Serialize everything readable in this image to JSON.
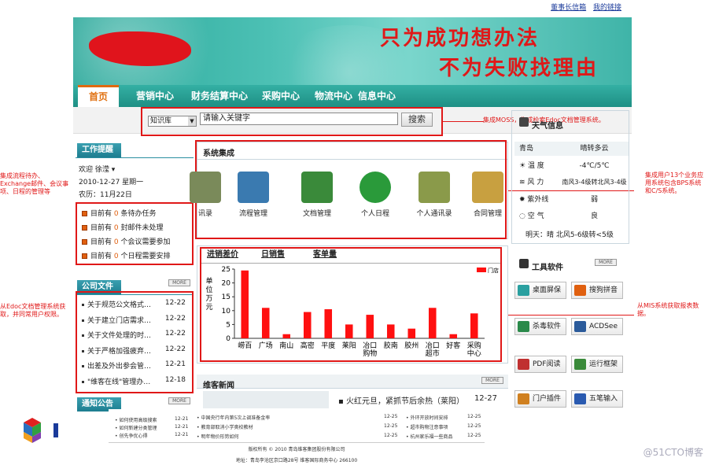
{
  "top_links": [
    "董事长信箱",
    "我的链接"
  ],
  "banner": {
    "slogan1": "只为成功想办法",
    "slogan2": "不为失败找理由"
  },
  "nav": [
    "首页",
    "营销中心",
    "财务结算中心",
    "采购中心",
    "物流中心",
    "信息中心"
  ],
  "search": {
    "kb_value": "知识库",
    "placeholder": "请输入关键字",
    "button": "搜索"
  },
  "annotations": {
    "search": "集成MOSS，集成检索Edoc文档管理系统。",
    "left_work": "集成流程待办、Exchange邮件、会议事项、日程的管理等",
    "left_docs": "从Edoc文档管理系统获取，并同常用户权限。",
    "right_sys": "集成用户13个业务应用系统包含BPS系统和C/S系统。",
    "right_chart": "从MIS系统获取报表数据。"
  },
  "work": {
    "title": "工作提醒",
    "welcome": "欢迎 徐滢",
    "date": "2010-12-27 星期一",
    "lunar": "农历：11月22日",
    "tasks": [
      {
        "pre": "目前有",
        "n": "0",
        "post": "条待办任务"
      },
      {
        "pre": "目前有",
        "n": "0",
        "post": "封邮件未处理"
      },
      {
        "pre": "目前有",
        "n": "0",
        "post": "个会议需要参加"
      },
      {
        "pre": "目前有",
        "n": "0",
        "post": "个日程需要安排"
      }
    ]
  },
  "docs": {
    "title": "公司文件",
    "more": "MORE",
    "items": [
      {
        "t": "关于规范公文格式…",
        "d": "12-22"
      },
      {
        "t": "关于建立门店需求…",
        "d": "12-22"
      },
      {
        "t": "关于文件处理的时…",
        "d": "12-22"
      },
      {
        "t": "关于严格加强疲弃…",
        "d": "12-22"
      },
      {
        "t": "出差及外出参会管…",
        "d": "12-21"
      },
      {
        "t": "\"维客在线\"管理办…",
        "d": "12-18"
      }
    ]
  },
  "notice": {
    "title": "通知公告",
    "more": "MORE"
  },
  "system": {
    "title": "系统集成",
    "items": [
      {
        "label": "讯录",
        "color": "#7a8a5a"
      },
      {
        "label": "流程管理",
        "color": "#3a7ab0"
      },
      {
        "label": "文档管理",
        "color": "#3a8a3a"
      },
      {
        "label": "个人日程",
        "color": "#2a9a3a"
      },
      {
        "label": "个人通讯录",
        "color": "#8a9a4a"
      },
      {
        "label": "合同管理",
        "color": "#c8a040"
      }
    ]
  },
  "chart_tabs": [
    "进销差价",
    "日销售",
    "客单量"
  ],
  "chart_data": {
    "type": "bar",
    "categories": [
      "崂百",
      "广场",
      "南山",
      "高密",
      "平度",
      "莱阳",
      "冶口购物",
      "胶南",
      "胶州",
      "冶口超市",
      "好客",
      "采购中心"
    ],
    "values": [
      24.5,
      11,
      1.5,
      9.5,
      10.5,
      5,
      8.5,
      5,
      3.5,
      11,
      1.5,
      9
    ],
    "ylabel": "单位：万元",
    "ylim": [
      0,
      25
    ],
    "yticks": [
      0,
      5,
      10,
      15,
      20,
      25
    ],
    "series": [
      {
        "name": "门店",
        "color": "#ff1010"
      }
    ]
  },
  "news": {
    "title": "维客新闻",
    "more": "MORE",
    "items": [
      {
        "t": "火红元旦，紧抓节后余热（莱阳）",
        "d": "12-27"
      }
    ]
  },
  "weather": {
    "title": "天气信息",
    "city": "青岛",
    "sky": "晴转多云",
    "rows": [
      {
        "k": "温 度",
        "v": "-4℃/5℃"
      },
      {
        "k": "风 力",
        "v": "南风3-4级转北风3-4级"
      },
      {
        "k": "紫外线",
        "v": "弱"
      },
      {
        "k": "空 气",
        "v": "良"
      }
    ],
    "tomorrow": "明天：晴 北风5-6级转<5级"
  },
  "tools": {
    "title": "工具软件",
    "more": "MORE",
    "items": [
      {
        "label": "桌面屏保",
        "color": "#2aa0a0"
      },
      {
        "label": "搜狗拼音",
        "color": "#e06010"
      },
      {
        "label": "杀毒软件",
        "color": "#2a8a4a"
      },
      {
        "label": "ACDSee",
        "color": "#2a5a9a"
      },
      {
        "label": "PDF阅读",
        "color": "#c03030"
      },
      {
        "label": "运行框架",
        "color": "#3a8a3a"
      },
      {
        "label": "门户插件",
        "color": "#d08020"
      },
      {
        "label": "五笔输入",
        "color": "#2a5ab0"
      }
    ]
  },
  "footer": {
    "left_items": [
      {
        "t": "如何使用高级搜索",
        "d": "12-21"
      },
      {
        "t": "如何新建分类管理",
        "d": "12-21"
      },
      {
        "t": "创先争优心得",
        "d": "12-21"
      }
    ],
    "mid_items": [
      {
        "t": "中国央行年内第5次上调准备金率",
        "d": "12-25"
      },
      {
        "t": "教育部取消小学奥校教材",
        "d": "12-25"
      },
      {
        "t": "明年物价形势如何",
        "d": "12-25"
      }
    ],
    "right_items": [
      {
        "t": "外环开放时间安排",
        "d": "12-25"
      },
      {
        "t": "超市购物注意事项",
        "d": "12-25"
      },
      {
        "t": "杭州家乐福一些商品",
        "d": "12-25"
      }
    ],
    "copyright": "版权所有 © 2010 青岛维客集团股份有限公司",
    "address": "地址：青岛李沧区京口路28号 维客国际商务中心 266100"
  },
  "watermark": "@51CTO博客"
}
